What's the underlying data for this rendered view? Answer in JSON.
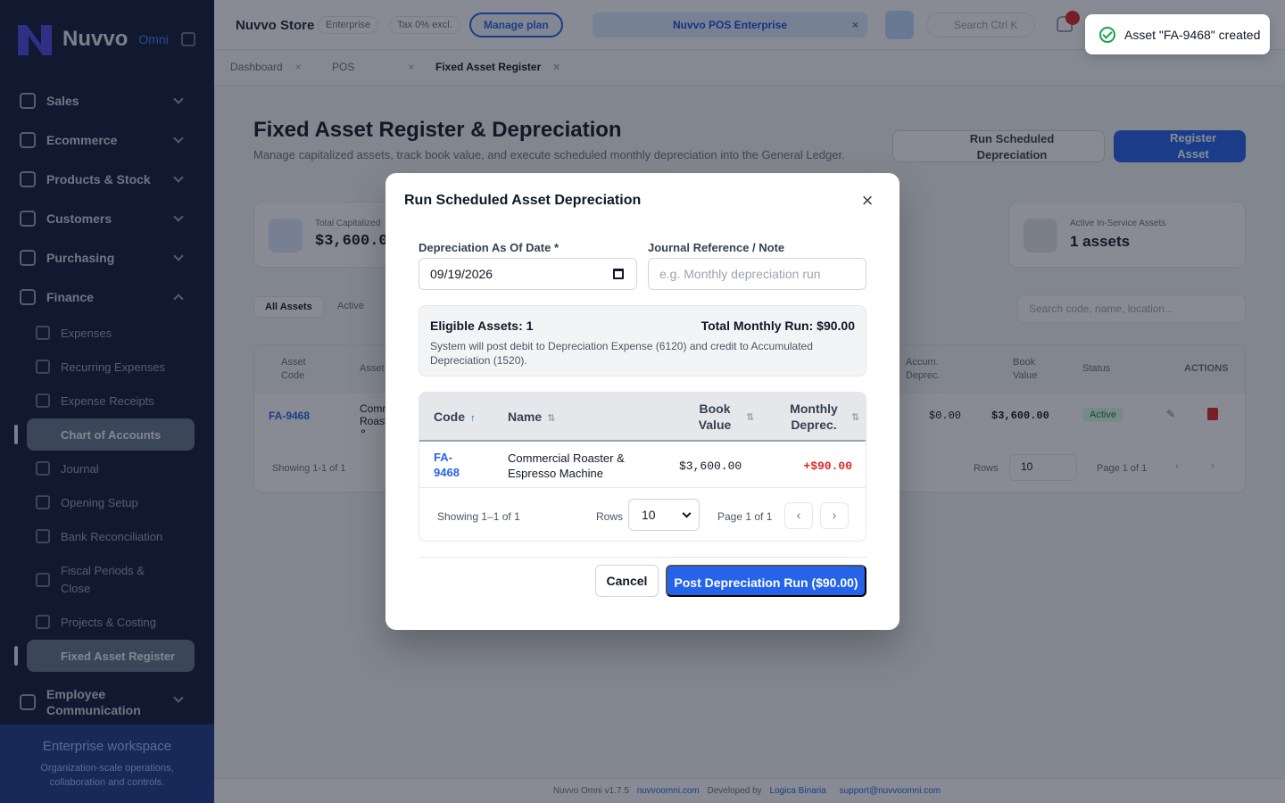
{
  "app": {
    "brand": "Nuvvo",
    "brand_sub": "Omni"
  },
  "sidebar": {
    "items": [
      {
        "label": "Sales"
      },
      {
        "label": "Ecommerce"
      },
      {
        "label": "Products & Stock"
      },
      {
        "label": "Customers"
      },
      {
        "label": "Purchasing"
      },
      {
        "label": "Finance"
      }
    ],
    "finance_items": [
      {
        "label": "Expenses"
      },
      {
        "label": "Recurring Expenses"
      },
      {
        "label": "Expense Receipts"
      },
      {
        "label": "Chart of Accounts"
      },
      {
        "label": "Journal"
      },
      {
        "label": "Opening Setup"
      },
      {
        "label": "Bank Reconciliation"
      },
      {
        "label": "Fiscal Periods & Close"
      },
      {
        "label": "Projects & Costing"
      },
      {
        "label": "Fixed Asset Register"
      }
    ],
    "employee_comm": "Employee Communication",
    "workspace_title": "Enterprise workspace",
    "workspace_desc": "Organization-scale operations, collaboration and controls."
  },
  "topbar": {
    "store_name": "Nuvvo Store",
    "tier": "Enterprise",
    "tax": "Tax 0% excl.",
    "manage_plan": "Manage plan",
    "pos_select": "Nuvvo POS Enterprise",
    "search": "Search",
    "search_shortcut": "Ctrl K"
  },
  "tabs": [
    {
      "label": "Dashboard"
    },
    {
      "label": "POS"
    },
    {
      "label": "Fixed Asset Register"
    }
  ],
  "page": {
    "title": "Fixed Asset Register & Depreciation",
    "description": "Manage capitalized assets, track book value, and execute scheduled monthly depreciation into the General Ledger.",
    "run_button": "Run Scheduled Depreciation",
    "register_button": "Register Asset"
  },
  "stats": [
    {
      "label": "Total Capitalized",
      "value": "$3,600.00"
    },
    {
      "label": "Active In-Service Assets",
      "value": "1 assets"
    }
  ],
  "filters": {
    "all": "All Assets",
    "active": "Active",
    "search_placeholder": "Search code, name, location..."
  },
  "bg_table": {
    "headers": {
      "code": "Asset Code",
      "name": "Asset",
      "accum": "Accum. Deprec.",
      "book": "Book Value",
      "status": "Status",
      "actions": "ACTIONS"
    },
    "row": {
      "code": "FA-9468",
      "name": "Commercial Roaster & Espresso Machine",
      "accum": "$0.00",
      "book": "$3,600.00",
      "status": "Active"
    },
    "showing": "Showing 1-1 of 1",
    "rows_label": "Rows",
    "rows_value": "10",
    "page": "Page 1 of 1"
  },
  "footer": {
    "version": "Nuvvo Omni v1.7.5",
    "site": "nuvvoomni.com",
    "dev_prefix": "Developed by",
    "dev": "Logica Binaria",
    "email": "support@nuvvoomni.com"
  },
  "modal": {
    "title": "Run Scheduled Asset Depreciation",
    "date_label": "Depreciation As Of Date *",
    "date_value": "09/19/2026",
    "ref_label": "Journal Reference / Note",
    "ref_placeholder": "e.g. Monthly depreciation run",
    "eligible": "Eligible Assets: 1",
    "total": "Total Monthly Run: $90.00",
    "note": "System will post debit to Depreciation Expense (6120) and credit to Accumulated Depreciation (1520).",
    "table": {
      "headers": {
        "code": "Code",
        "name": "Name",
        "book": "Book Value",
        "monthly": "Monthly Deprec."
      },
      "rows": [
        {
          "code": "FA-9468",
          "name": "Commercial Roaster & Espresso Machine",
          "book": "$3,600.00",
          "monthly": "+$90.00"
        }
      ],
      "showing": "Showing 1–1 of 1",
      "rows_label": "Rows",
      "rows_value": "10",
      "page": "Page 1 of 1"
    },
    "cancel": "Cancel",
    "post": "Post Depreciation Run ($90.00)"
  },
  "toast": {
    "message": "Asset \"FA-9468\" created"
  },
  "colors": {
    "primary": "#2563eb",
    "sidebar": "#111a3a",
    "danger": "#dc2626",
    "success": "#16a34a"
  }
}
